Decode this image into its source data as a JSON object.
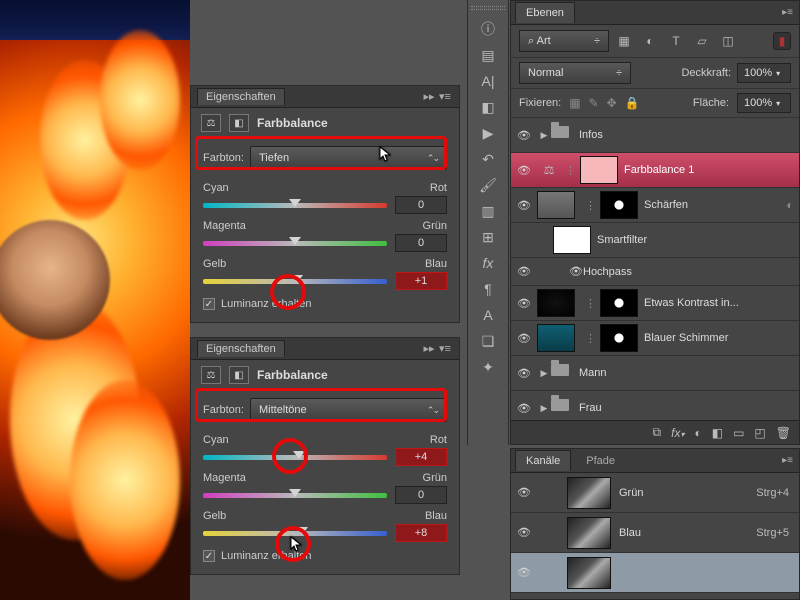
{
  "canvas": {},
  "properties_panels": [
    {
      "panel_title": "Eigenschaften",
      "adj_title": "Farbbalance",
      "tone_label": "Farbton:",
      "tone_value": "Tiefen",
      "sliders": [
        {
          "left": "Cyan",
          "right": "Rot",
          "value": "0",
          "hot": false,
          "pos": 50
        },
        {
          "left": "Magenta",
          "right": "Grün",
          "value": "0",
          "hot": false,
          "pos": 50
        },
        {
          "left": "Gelb",
          "right": "Blau",
          "value": "+1",
          "hot": true,
          "pos": 51
        }
      ],
      "preserve_lum": "Luminanz erhalten",
      "preserve_checked": true,
      "highlight_dropdown": true,
      "circles": [
        {
          "slider": 2
        }
      ],
      "cursor_on_dropdown": true
    },
    {
      "panel_title": "Eigenschaften",
      "adj_title": "Farbbalance",
      "tone_label": "Farbton:",
      "tone_value": "Mitteltöne",
      "sliders": [
        {
          "left": "Cyan",
          "right": "Rot",
          "value": "+4",
          "hot": true,
          "pos": 52
        },
        {
          "left": "Magenta",
          "right": "Grün",
          "value": "0",
          "hot": false,
          "pos": 50
        },
        {
          "left": "Gelb",
          "right": "Blau",
          "value": "+8",
          "hot": true,
          "pos": 54
        }
      ],
      "preserve_lum": "Luminanz erhalten",
      "preserve_checked": true,
      "highlight_dropdown": true,
      "circles": [
        {
          "slider": 0
        },
        {
          "slider": 2
        }
      ],
      "cursor_on_slider3": true
    }
  ],
  "layers_panel": {
    "tab": "Ebenen",
    "kind_label": "Art",
    "kind_search": "⌕",
    "blend_mode": "Normal",
    "opacity_label": "Deckkraft:",
    "opacity_value": "100%",
    "lock_label": "Fixieren:",
    "fill_label": "Fläche:",
    "fill_value": "100%",
    "layers": [
      {
        "type": "group",
        "name": "Infos",
        "open": false,
        "eye": true,
        "indent": 0,
        "folder": true
      },
      {
        "type": "adj",
        "name": "Farbbalance 1",
        "eye": true,
        "selected": true,
        "indent": 0
      },
      {
        "type": "smart",
        "name": "Schärfen",
        "eye": true,
        "indent": 0,
        "thumb": "grey",
        "mask": "scatter"
      },
      {
        "type": "filterlabel",
        "name": "Smartfilter",
        "eye": false,
        "indent": 1,
        "maskonly": true
      },
      {
        "type": "filter",
        "name": "Hochpass",
        "eye": true,
        "indent": 2,
        "small": true
      },
      {
        "type": "layer",
        "name": "Etwas Kontrast in...",
        "eye": true,
        "indent": 0,
        "thumb": "dark",
        "mask": "scatter2"
      },
      {
        "type": "layer",
        "name": "Blauer Schimmer",
        "eye": true,
        "indent": 0,
        "thumb": "teal",
        "mask": "scatter2"
      },
      {
        "type": "group",
        "name": "Mann",
        "open": false,
        "eye": true,
        "indent": 0,
        "folder": true
      },
      {
        "type": "group",
        "name": "Frau",
        "open": false,
        "eye": true,
        "indent": 0,
        "folder": true
      }
    ],
    "foot_icons": [
      "∞",
      "fx",
      "◐",
      "◧",
      "▭",
      "🗑"
    ]
  },
  "channels_panel": {
    "tabs": [
      "Kanäle",
      "Pfade"
    ],
    "rows": [
      {
        "name": "Grün",
        "shortcut": "Strg+4",
        "sel": false
      },
      {
        "name": "Blau",
        "shortcut": "Strg+5",
        "sel": false
      },
      {
        "name": "",
        "shortcut": "",
        "sel": true
      }
    ]
  },
  "toolstrip_icons": [
    "info",
    "swatches",
    "text",
    "mask",
    "play",
    "history",
    "brush",
    "align",
    "pattern",
    "fx",
    "para",
    "char",
    "style",
    "3d"
  ]
}
